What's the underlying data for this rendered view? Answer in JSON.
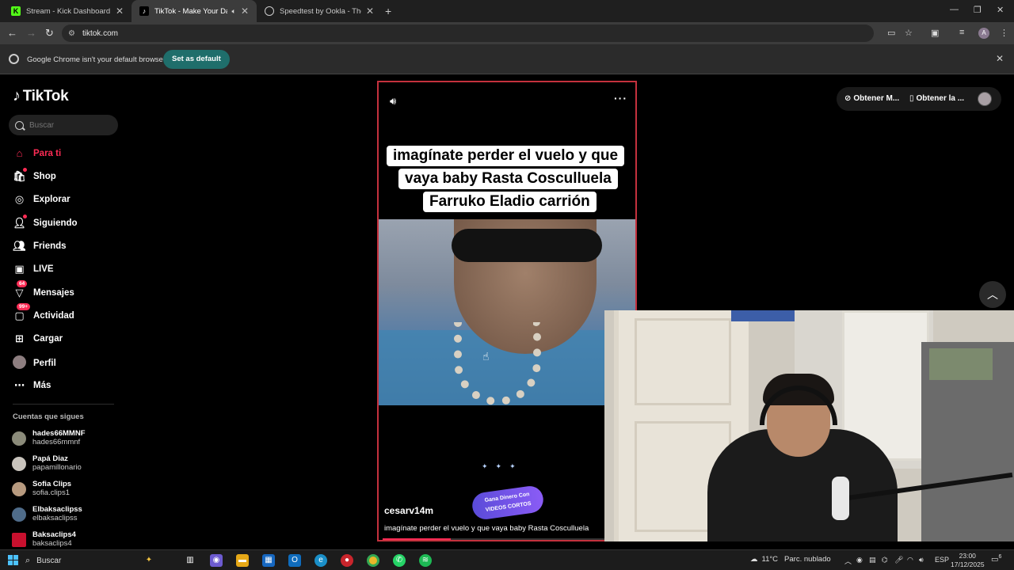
{
  "browser": {
    "tabs": [
      {
        "title": "Stream - Kick Dashboard",
        "favicon_color": "#53fc18"
      },
      {
        "title": "TikTok - Make Your Day",
        "favicon_color": "#000000",
        "active": true
      },
      {
        "title": "Speedtest by Ookla - The Glob",
        "favicon_color": "#1f1f1f"
      }
    ],
    "url": "tiktok.com",
    "infobar": {
      "message": "Google Chrome isn't your default browser",
      "button": "Set as default"
    },
    "profile_initial": "A"
  },
  "tiktok": {
    "logo": "TikTok",
    "search_placeholder": "Buscar",
    "nav": [
      {
        "label": "Para ti",
        "icon": "home-icon"
      },
      {
        "label": "Shop",
        "icon": "shop-icon"
      },
      {
        "label": "Explorar",
        "icon": "compass-icon"
      },
      {
        "label": "Siguiendo",
        "icon": "following-icon"
      },
      {
        "label": "Friends",
        "icon": "friends-icon"
      },
      {
        "label": "LIVE",
        "icon": "live-icon"
      },
      {
        "label": "Mensajes",
        "icon": "messages-icon",
        "badge": "64"
      },
      {
        "label": "Actividad",
        "icon": "activity-icon",
        "badge": "99+"
      },
      {
        "label": "Cargar",
        "icon": "upload-icon"
      },
      {
        "label": "Perfil",
        "icon": "profile-avatar"
      },
      {
        "label": "Más",
        "icon": "more-icon"
      }
    ],
    "following_title": "Cuentas que sigues",
    "following": [
      {
        "name": "hades66MMNF",
        "handle": "hades66mmnf"
      },
      {
        "name": "Papá Diaz",
        "handle": "papamillonario"
      },
      {
        "name": "Sofia Clips",
        "handle": "sofia.clips1"
      },
      {
        "name": "Elbaksaclipss",
        "handle": "elbaksaclipss"
      },
      {
        "name": "Baksaclips4",
        "handle": "baksaclips4"
      }
    ],
    "header": {
      "get_coins": "Obtener M...",
      "get_app": "Obtener la ..."
    },
    "video": {
      "caption_lines": [
        "imagínate perder el vuelo y que",
        "vaya baby Rasta Cosculluela",
        "Farruko Eladio carrión"
      ],
      "author": "cesarv14m",
      "description": "imagínate perder el vuelo y que vaya baby Rasta Cosculluela",
      "progress_percent": 27,
      "promo_text_line1": "Gana Dinero Con",
      "promo_text_line2": "VIDEOS CORTOS"
    }
  },
  "taskbar": {
    "search": "Buscar",
    "weather_temp": "11°C",
    "weather_desc": "Parc. nublado",
    "language": "ESP",
    "time": "23:00",
    "date": "17/12/2025",
    "notifications": "6"
  }
}
